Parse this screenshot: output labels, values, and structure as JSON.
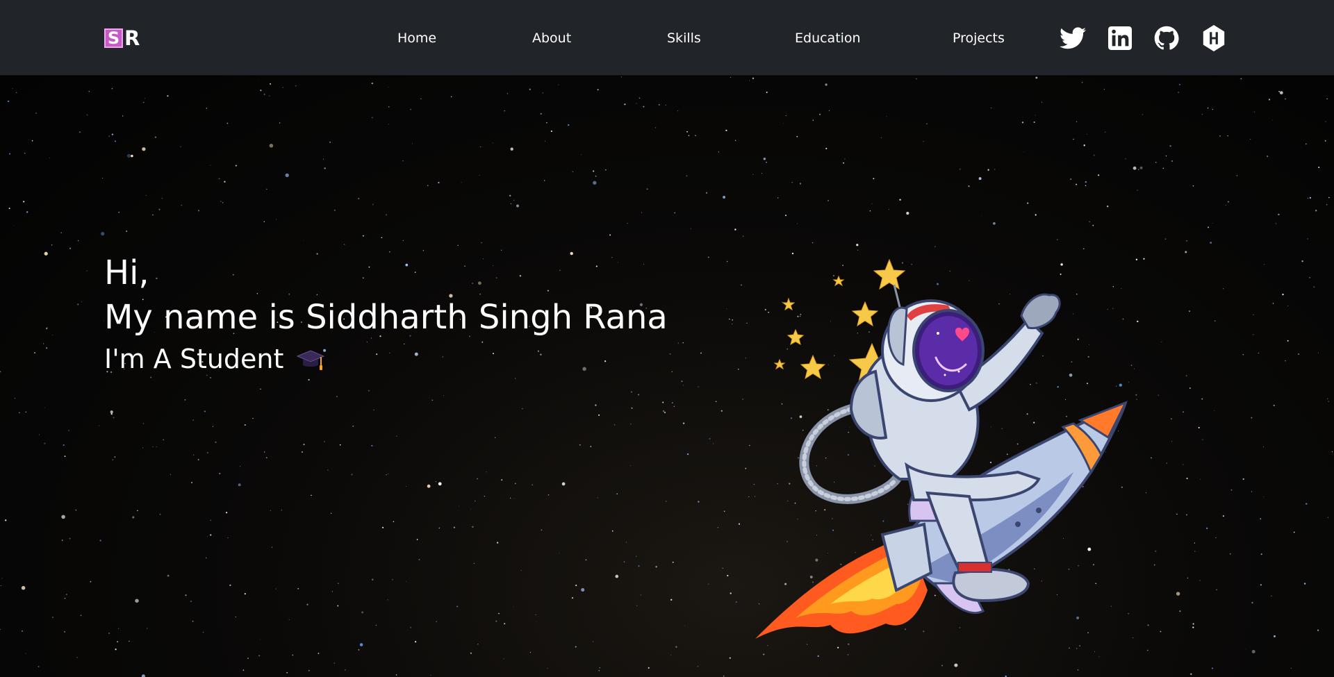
{
  "logo": {
    "letter_1": "S",
    "letter_2": "R",
    "accent_color": "#c85ac8"
  },
  "nav": {
    "items": [
      {
        "label": "Home"
      },
      {
        "label": "About"
      },
      {
        "label": "Skills"
      },
      {
        "label": "Education"
      },
      {
        "label": "Projects"
      }
    ],
    "background": "#212529"
  },
  "social": [
    {
      "icon": "twitter-icon"
    },
    {
      "icon": "linkedin-icon"
    },
    {
      "icon": "github-icon"
    },
    {
      "icon": "hashnode-icon"
    }
  ],
  "hero": {
    "greeting": "Hi,",
    "name_line": "My name is Siddharth Singh Rana",
    "role_line": "I'm A Student",
    "role_icon": "graduation-cap-icon",
    "illustration": "astronaut-riding-rocket"
  }
}
